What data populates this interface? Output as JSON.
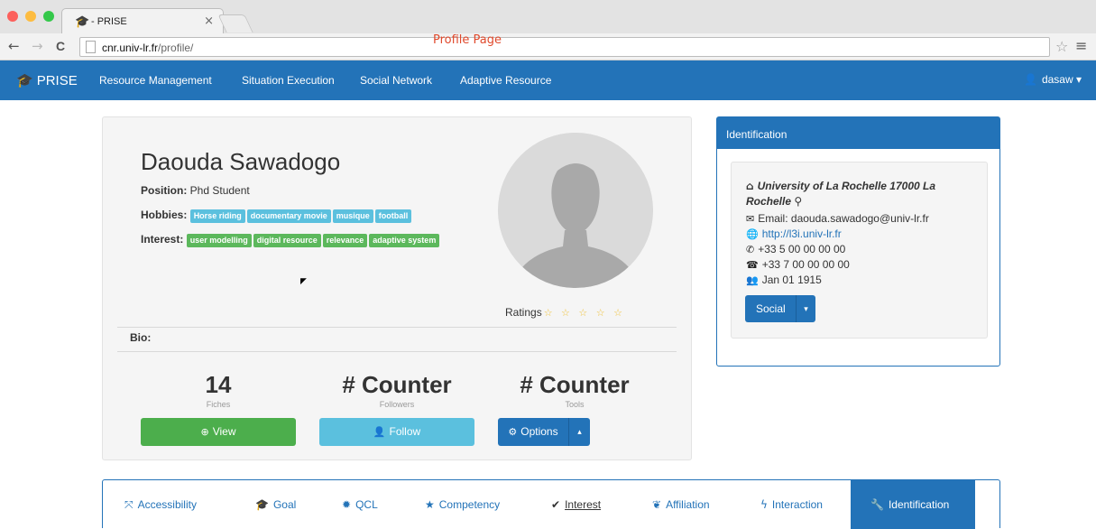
{
  "browser": {
    "tab_title": "- PRISE",
    "tab_close": "×",
    "back": "←",
    "forward": "→",
    "reload": "C",
    "url_host": "cnr.univ-lr.fr",
    "url_path": "/profile/",
    "annotation": "Profile Page",
    "bookmark": "☆",
    "menu": "≡"
  },
  "navbar": {
    "brand": "PRISE",
    "links": [
      "Resource Management",
      "Situation Execution",
      "Social Network",
      "Adaptive Resource"
    ],
    "user": "dasaw"
  },
  "profile": {
    "name": "Daouda Sawadogo",
    "position_label": "Position:",
    "position": "Phd Student",
    "hobbies_label": "Hobbies:",
    "hobbies": [
      "Horse riding",
      "documentary movie",
      "musique",
      "football"
    ],
    "interest_label": "Interest:",
    "interests": [
      "user modelling",
      "digital resource",
      "relevance",
      "adaptive system"
    ],
    "ratings_label": "Ratings",
    "ratings_stars": "☆ ☆ ☆ ☆ ☆",
    "bio_label": "Bio:",
    "stats": [
      {
        "value": "14",
        "caption": "Fiches"
      },
      {
        "value": "# Counter",
        "caption": "Followers"
      },
      {
        "value": "# Counter",
        "caption": "Tools"
      }
    ],
    "buttons": {
      "view": "View",
      "follow": "Follow",
      "options": "Options"
    }
  },
  "identification": {
    "title": "Identification",
    "university": "University of La Rochelle 17000 La Rochelle",
    "email": "Email: daouda.sawadogo@univ-lr.fr",
    "website": "http://l3i.univ-lr.fr",
    "phone": "+33 5 00 00 00 00",
    "fax": "+33 7 00 00 00 00",
    "birthdate": "Jan 01 1915",
    "social_button": "Social"
  },
  "tabs": [
    "Accessibility",
    "Goal",
    "QCL",
    "Competency",
    "Interest",
    "Affiliation",
    "Interaction",
    "Identification"
  ],
  "colors": {
    "primary": "#2373b8",
    "success": "#4cae4c",
    "info": "#5bc0de",
    "star": "#f0c23b"
  }
}
